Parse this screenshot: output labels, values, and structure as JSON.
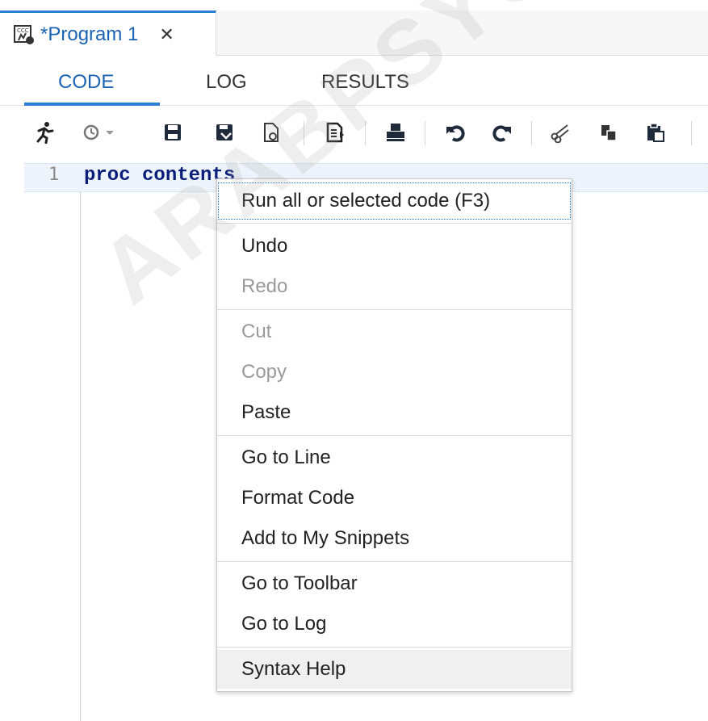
{
  "doc_tab": {
    "title": "*Program 1",
    "close_icon": "close-icon"
  },
  "subtabs": [
    "CODE",
    "LOG",
    "RESULTS"
  ],
  "active_subtab": "CODE",
  "toolbar": {
    "buttons": [
      "run-icon",
      "history-icon",
      "save-icon",
      "save-as-icon",
      "download-icon",
      "export-icon",
      "print-icon",
      "undo-icon",
      "redo-icon",
      "cut-icon",
      "copy-icon",
      "paste-icon"
    ]
  },
  "editor": {
    "line_number": "1",
    "code": "proc contents"
  },
  "context_menu": {
    "groups": [
      [
        {
          "label": "Run all or selected code (F3)",
          "enabled": true,
          "focused": true
        }
      ],
      [
        {
          "label": "Undo",
          "enabled": true
        },
        {
          "label": "Redo",
          "enabled": false
        }
      ],
      [
        {
          "label": "Cut",
          "enabled": false
        },
        {
          "label": "Copy",
          "enabled": false
        },
        {
          "label": "Paste",
          "enabled": true
        }
      ],
      [
        {
          "label": "Go to Line",
          "enabled": true
        },
        {
          "label": "Format Code",
          "enabled": true
        },
        {
          "label": "Add to My Snippets",
          "enabled": true
        }
      ],
      [
        {
          "label": "Go to Toolbar",
          "enabled": true
        },
        {
          "label": "Go to Log",
          "enabled": true
        }
      ],
      [
        {
          "label": "Syntax Help",
          "enabled": true,
          "hover": true
        }
      ]
    ]
  },
  "watermark": "ARABPSYCHOLOGY",
  "colors": {
    "accent": "#2a7fd4",
    "tab_text": "#1a63b5",
    "keyword": "#0b1f7a",
    "disabled": "#9a9a9a"
  }
}
